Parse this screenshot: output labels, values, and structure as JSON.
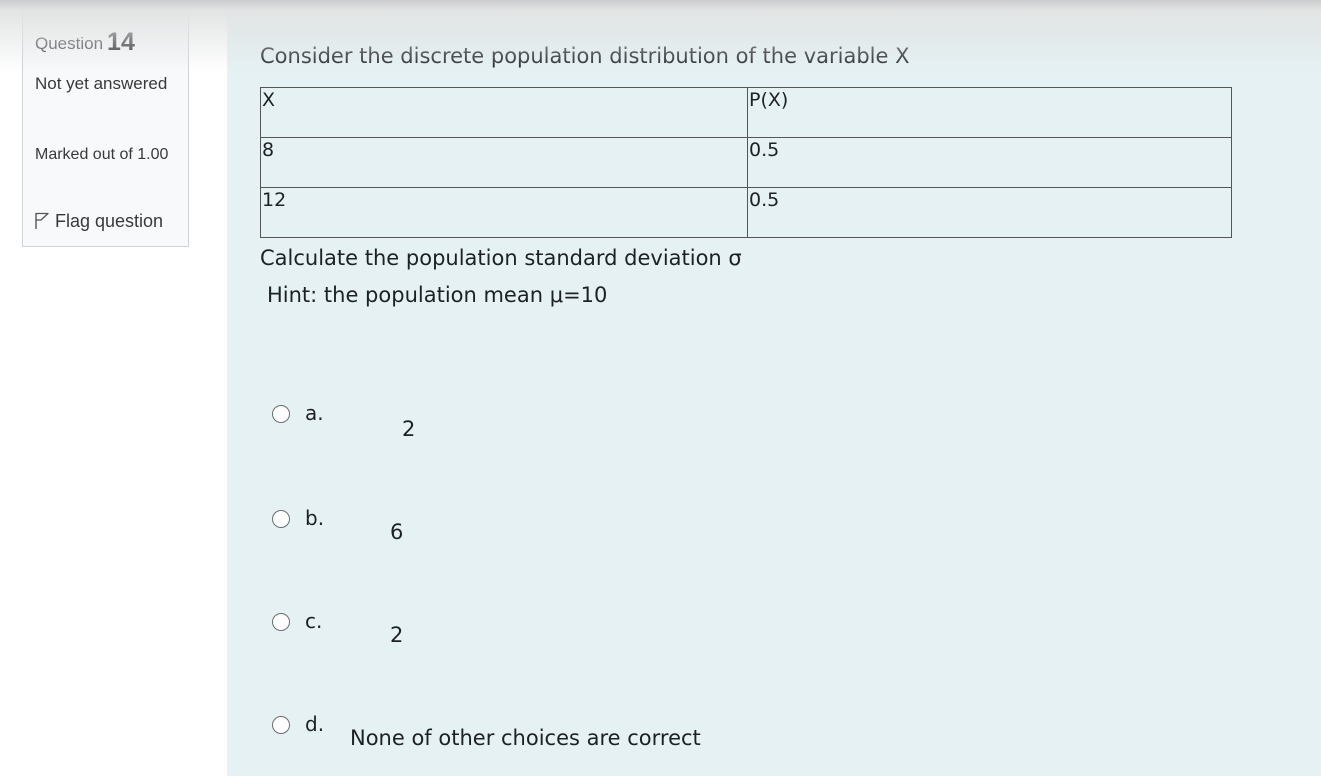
{
  "info": {
    "question_label": "Question",
    "question_number": "14",
    "state": "Not yet answered",
    "grade": "Marked out of 1.00",
    "flag_label": "Flag question"
  },
  "question": {
    "text": "Consider the discrete population distribution of the variable X",
    "table": {
      "headers": [
        "X",
        "P(X)"
      ],
      "rows": [
        [
          "8",
          "0.5"
        ],
        [
          "12",
          "0.5"
        ]
      ]
    },
    "instruction": "Calculate the population standard deviation σ",
    "hint": "Hint: the population mean μ=10"
  },
  "options": [
    {
      "letter": "a.",
      "value": "2"
    },
    {
      "letter": "b.",
      "value": "6"
    },
    {
      "letter": "c.",
      "value": "2"
    },
    {
      "letter": "d.",
      "value": "None of other choices are correct"
    }
  ]
}
